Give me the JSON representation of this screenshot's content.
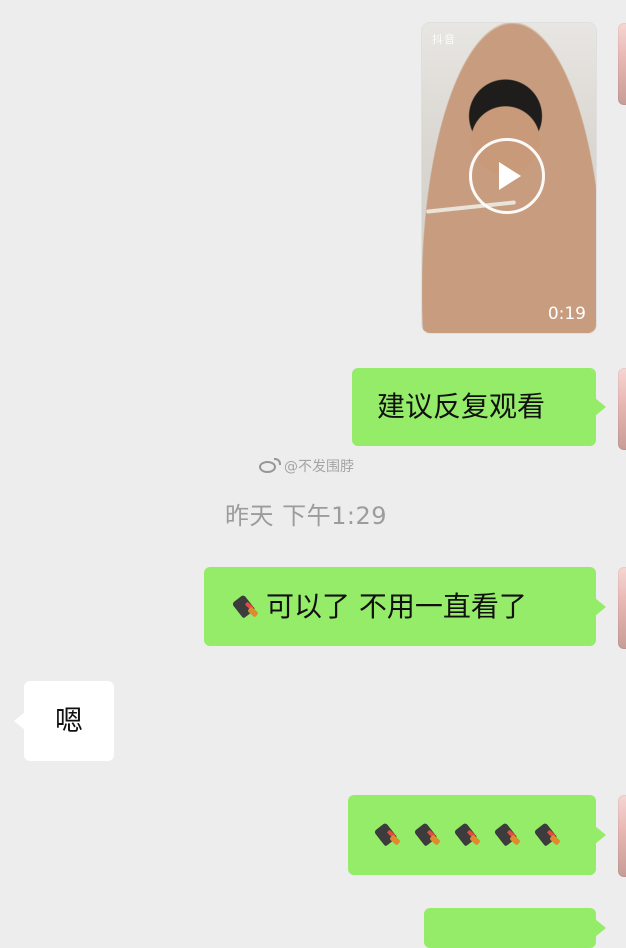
{
  "video": {
    "duration": "0:19",
    "label": "抖音"
  },
  "messages": {
    "m1": "建议反复观看",
    "m2_text": "可以了 不用一直看了",
    "m3": "嗯"
  },
  "timestamp": "昨天 下午1:29",
  "watermark": "@不发围脖",
  "colors": {
    "background": "#ededed",
    "sent_bubble": "#95ec69",
    "received_bubble": "#ffffff",
    "timestamp_text": "#9c9c9c"
  },
  "icons": {
    "emoji": "sweeping-broom-emoji",
    "play": "play-icon",
    "weibo": "weibo-icon"
  }
}
